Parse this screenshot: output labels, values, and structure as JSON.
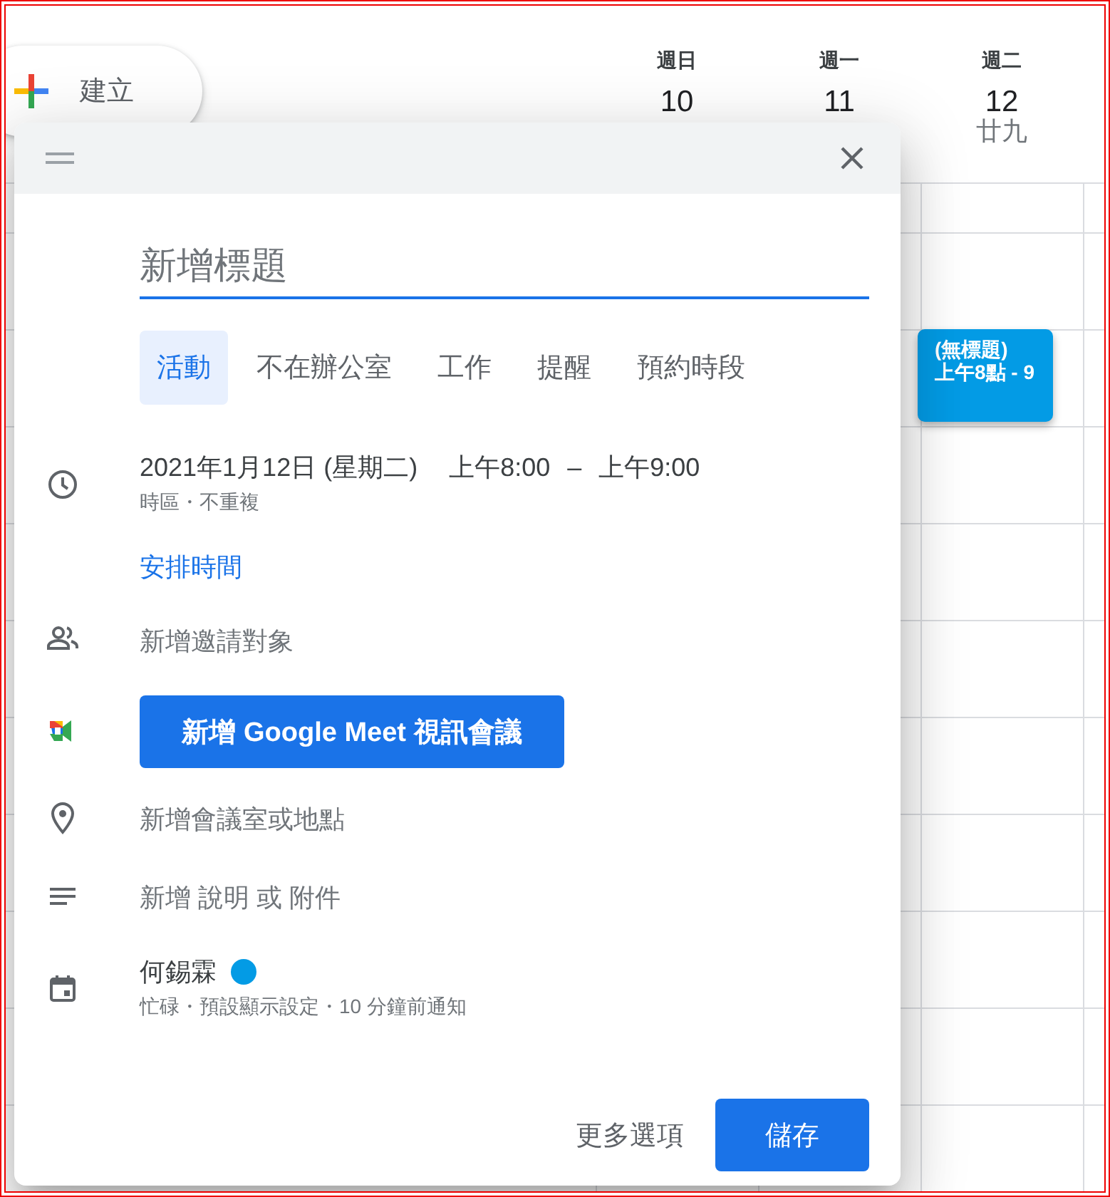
{
  "create_button": {
    "label": "建立"
  },
  "days": [
    {
      "weekday": "週日",
      "date": "10"
    },
    {
      "weekday": "週一",
      "date": "11"
    },
    {
      "weekday": "週二",
      "date": "12",
      "lunar": "廿九"
    }
  ],
  "event_chip": {
    "title": "(無標題)",
    "time": "上午8點 - 9",
    "color": "#039be5"
  },
  "dialog": {
    "title_field": {
      "placeholder": "新增標題"
    },
    "types": [
      {
        "label": "活動",
        "selected": true
      },
      {
        "label": "不在辦公室",
        "selected": false
      },
      {
        "label": "工作",
        "selected": false
      },
      {
        "label": "提醒",
        "selected": false
      },
      {
        "label": "預約時段",
        "selected": false
      }
    ],
    "date_time": {
      "date": "2021年1月12日 (星期二)",
      "start": "上午8:00",
      "separator": "–",
      "end": "上午9:00",
      "details": "時區・不重複"
    },
    "find_time_link": "安排時間",
    "guests": {
      "label": "新增邀請對象"
    },
    "meet_button": "新增 Google Meet 視訊會議",
    "location": {
      "label": "新增會議室或地點"
    },
    "description": {
      "label": "新增 說明 或 附件"
    },
    "calendar": {
      "owner": "何錫霖",
      "color": "#039be5",
      "details": "忙碌・預設顯示設定・10 分鐘前通知"
    },
    "more_options": "更多選項",
    "save": "儲存"
  }
}
